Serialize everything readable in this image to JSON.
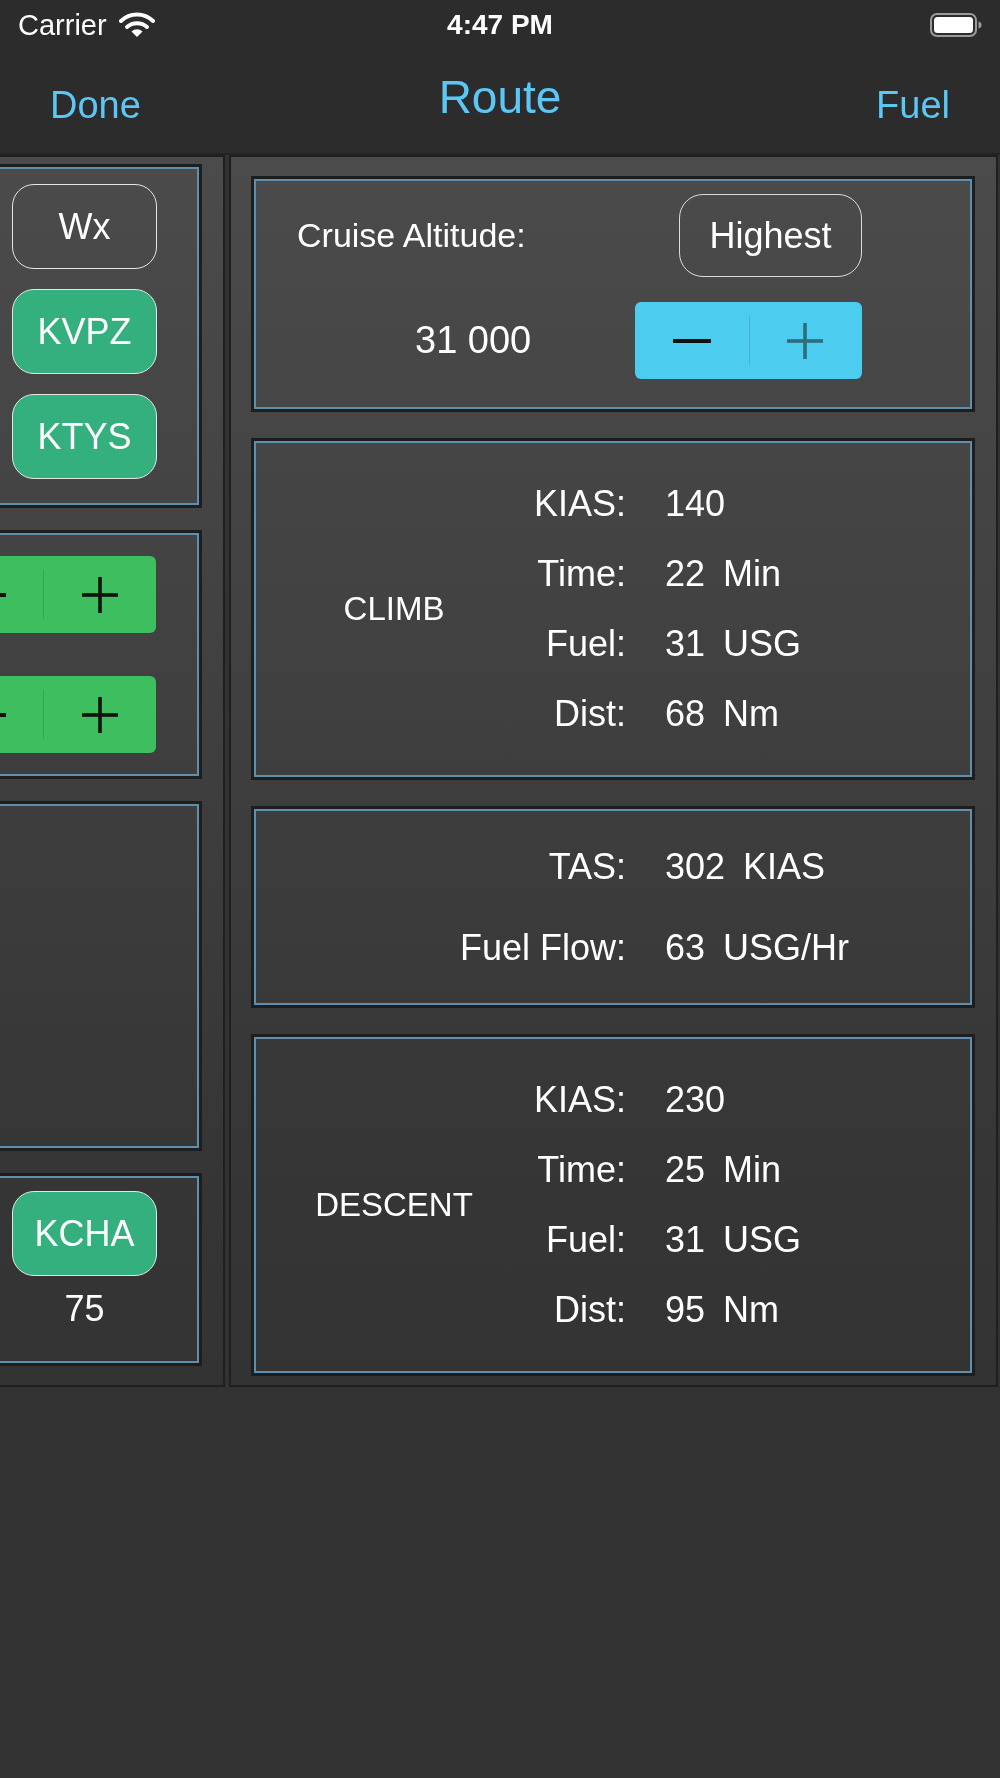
{
  "status_bar": {
    "carrier": "Carrier",
    "time": "4:47 PM"
  },
  "nav_bar": {
    "left_button": "Done",
    "title": "Route",
    "right_button": "Fuel"
  },
  "left_panel": {
    "cards": [
      {
        "kind": "buttons",
        "buttons": [
          {
            "label": "Wx",
            "kind": "outline"
          },
          {
            "label": "KVPZ",
            "kind": "filled"
          },
          {
            "label": "KTYS",
            "kind": "filled"
          }
        ]
      },
      {
        "kind": "steppers",
        "steppers": [
          {
            "segments": [
              {
                "kind": "decrement",
                "disabled": false
              },
              {
                "kind": "increment",
                "disabled": false
              }
            ]
          },
          {
            "segments": [
              {
                "kind": "decrement",
                "disabled": false
              },
              {
                "kind": "increment",
                "disabled": false
              }
            ]
          }
        ]
      },
      {
        "kind": "blank"
      },
      {
        "kind": "airport",
        "button": {
          "label": "KCHA",
          "kind": "filled"
        },
        "value": "75"
      }
    ]
  },
  "cruise_altitude": {
    "label": "Cruise Altitude:",
    "button": "Highest",
    "value": "31 000",
    "stepper": {
      "segments": [
        {
          "kind": "decrement",
          "disabled": false
        },
        {
          "kind": "increment",
          "disabled": true
        }
      ]
    }
  },
  "phases": [
    {
      "title": "CLIMB",
      "rows": [
        {
          "label": "KIAS:",
          "value": "140"
        },
        {
          "label": "Time:",
          "value": "22",
          "unit": "Min"
        },
        {
          "label": "Fuel:",
          "value": "31",
          "unit": "USG"
        },
        {
          "label": "Dist:",
          "value": "68",
          "unit": "Nm"
        }
      ]
    },
    {
      "rows": [
        {
          "label": "TAS:",
          "value": "302",
          "unit": "KIAS"
        },
        {
          "label": "Fuel Flow:",
          "value": "63",
          "unit": "USG/Hr"
        }
      ]
    },
    {
      "title": "DESCENT",
      "rows": [
        {
          "label": "KIAS:",
          "value": "230"
        },
        {
          "label": "Time:",
          "value": "25",
          "unit": "Min"
        },
        {
          "label": "Fuel:",
          "value": "31",
          "unit": "USG"
        },
        {
          "label": "Dist:",
          "value": "95",
          "unit": "Nm"
        }
      ]
    }
  ]
}
